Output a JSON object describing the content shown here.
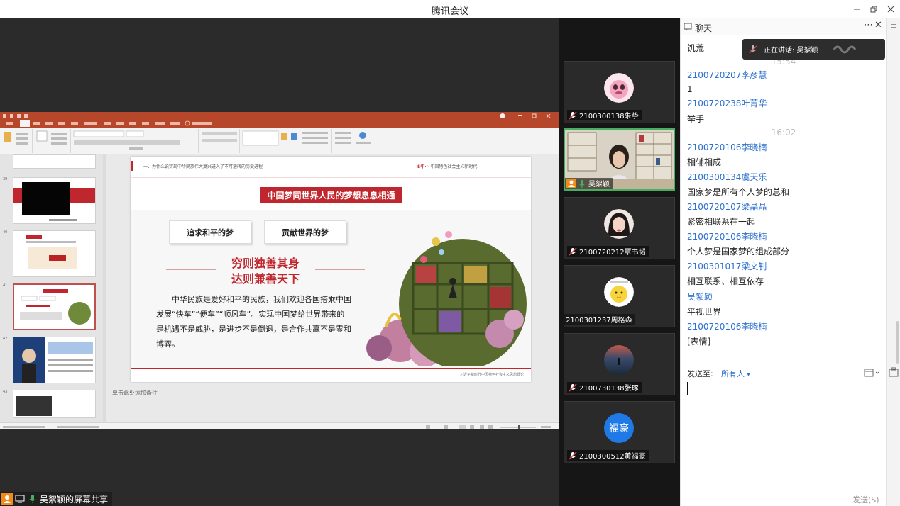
{
  "window": {
    "title": "腾讯会议"
  },
  "presentation": {
    "slide": {
      "breadcrumb": "一、为什么说实现中华民族伟大复兴进入了不可逆转的历史进程",
      "brand": "中国特色社会主义新时代",
      "headline": "中国梦同世界人民的梦想息息相通",
      "box_left": "追求和平的梦",
      "box_right": "贡献世界的梦",
      "verse_1": "穷则独善其身",
      "verse_2": "达则兼善天下",
      "body": "中华民族是爱好和平的民族，我们欢迎各国搭乘中国发展“快车”“便车”“顺风车”。实现中国梦给世界带来的是机遇不是威胁，是进步不是倒退，是合作共赢不是零和博弈。",
      "footer": "习近平新时代中国特色社会主义思想概论"
    },
    "notes_placeholder": "单击此处添加备注",
    "thumb_numbers": [
      "39",
      "40",
      "41",
      "42",
      "43"
    ]
  },
  "share_label": "吴絮颖的屏幕共享",
  "participants": [
    {
      "name": "2100300138朱挚",
      "muted": true
    },
    {
      "name": "吴絮颖",
      "muted": false,
      "speaking": true
    },
    {
      "name": "2100720212覃书韬",
      "muted": true
    },
    {
      "name": "2100301237周格森",
      "muted": false
    },
    {
      "name": "2100730138张琢",
      "muted": true
    },
    {
      "name": "2100300512黄福豪",
      "muted": true,
      "avatar_text": "福豪"
    }
  ],
  "chat": {
    "title": "聊天",
    "toast": "正在讲话: 吴絮颖",
    "messages": [
      {
        "kind": "text",
        "value": "饥荒"
      },
      {
        "kind": "time",
        "value": "15:54"
      },
      {
        "kind": "sender",
        "value": "2100720207李彦慧"
      },
      {
        "kind": "text",
        "value": "1"
      },
      {
        "kind": "sender",
        "value": "2100720238叶菁华"
      },
      {
        "kind": "text",
        "value": "举手"
      },
      {
        "kind": "time",
        "value": "16:02"
      },
      {
        "kind": "sender",
        "value": "2100720106李晓楠"
      },
      {
        "kind": "text",
        "value": "相辅相成"
      },
      {
        "kind": "sender",
        "value": "2100300134虞天乐"
      },
      {
        "kind": "text",
        "value": "国家梦是所有个人梦的总和"
      },
      {
        "kind": "sender",
        "value": "2100720107梁晶晶"
      },
      {
        "kind": "text",
        "value": "紧密相联系在一起"
      },
      {
        "kind": "sender",
        "value": "2100720106李晓楠"
      },
      {
        "kind": "text",
        "value": "个人梦是国家梦的组成部分"
      },
      {
        "kind": "sender",
        "value": "2100301017梁文钊"
      },
      {
        "kind": "text",
        "value": "相互联系、相互依存"
      },
      {
        "kind": "sender",
        "value": "吴絮颖"
      },
      {
        "kind": "text",
        "value": "平视世界"
      },
      {
        "kind": "sender",
        "value": "2100720106李晓楠"
      },
      {
        "kind": "text",
        "value": "[表情]"
      }
    ],
    "send_to_label": "发送至:",
    "send_to_value": "所有人",
    "send_button": "发送(S)"
  },
  "colors": {
    "ppt_accent": "#b7472a",
    "slide_red": "#c0262d",
    "sender_blue": "#2a6fcf",
    "speaking_green": "#46b060"
  }
}
